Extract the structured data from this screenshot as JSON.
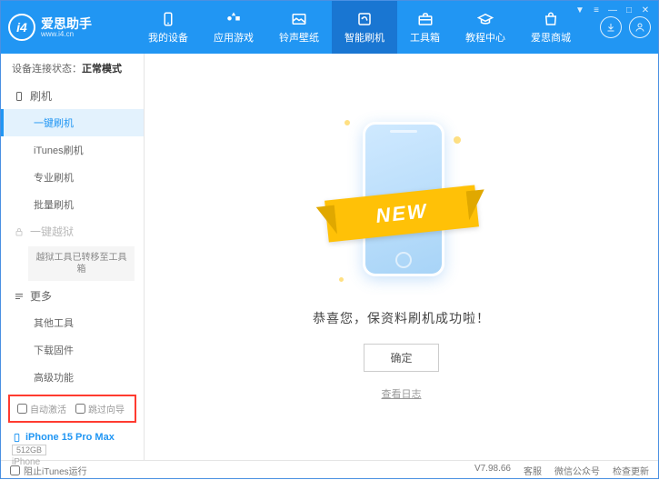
{
  "app": {
    "name": "爱思助手",
    "url": "www.i4.cn"
  },
  "nav": [
    {
      "label": "我的设备"
    },
    {
      "label": "应用游戏"
    },
    {
      "label": "铃声壁纸"
    },
    {
      "label": "智能刷机"
    },
    {
      "label": "工具箱"
    },
    {
      "label": "教程中心"
    },
    {
      "label": "爱思商城"
    }
  ],
  "status": {
    "label": "设备连接状态：",
    "value": "正常模式"
  },
  "sidebar": {
    "group_flash": "刷机",
    "items_flash": [
      "一键刷机",
      "iTunes刷机",
      "专业刷机",
      "批量刷机"
    ],
    "group_jailbreak": "一键越狱",
    "jailbreak_note": "越狱工具已转移至工具箱",
    "group_more": "更多",
    "items_more": [
      "其他工具",
      "下载固件",
      "高级功能"
    ]
  },
  "options": {
    "auto_activate": "自动激活",
    "skip_guide": "跳过向导"
  },
  "device": {
    "name": "iPhone 15 Pro Max",
    "storage": "512GB",
    "type": "iPhone"
  },
  "main": {
    "ribbon": "NEW",
    "message": "恭喜您，保资料刷机成功啦！",
    "ok": "确定",
    "log": "查看日志"
  },
  "footer": {
    "block_itunes": "阻止iTunes运行",
    "version": "V7.98.66",
    "links": [
      "客服",
      "微信公众号",
      "检查更新"
    ]
  }
}
